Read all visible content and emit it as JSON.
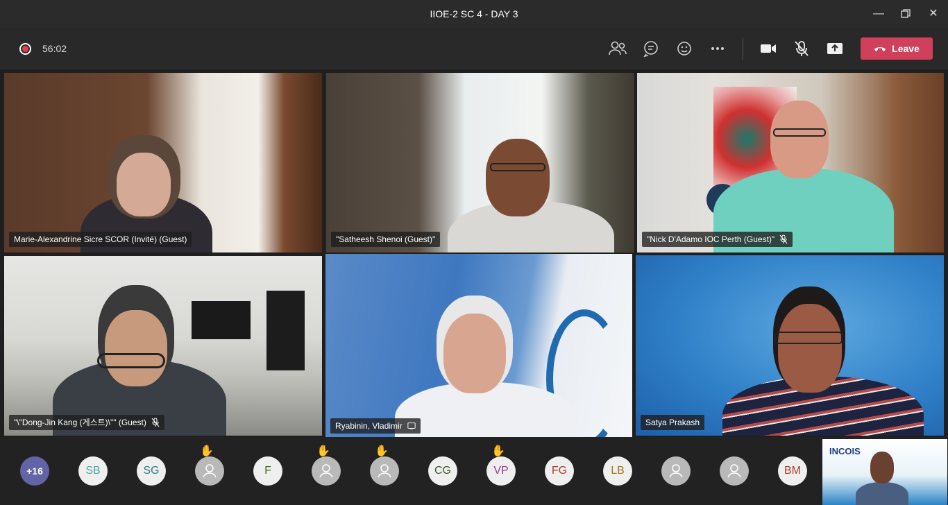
{
  "window": {
    "title": "IIOE-2 SC 4 - DAY 3"
  },
  "toolbar": {
    "timer": "56:02",
    "leave_label": "Leave",
    "icons": [
      "participants-icon",
      "chat-icon",
      "reactions-icon",
      "more-icon",
      "camera-icon",
      "mic-muted-icon",
      "share-icon"
    ],
    "leave_color": "#d0405a"
  },
  "tiles": [
    {
      "name": "Marie-Alexandrine Sicre SCOR (Invité) (Guest)",
      "muted": false
    },
    {
      "name": "\"Satheesh Shenoi (Guest)\"",
      "muted": false
    },
    {
      "name": "\"Nick D'Adamo IOC Perth (Guest)\"",
      "muted": true
    },
    {
      "name": "\"\\\"Dong-Jin Kang (게스트)\\\"\" (Guest)",
      "muted": true
    },
    {
      "name": "Ryabinin, Vladimir",
      "muted": false
    },
    {
      "name": "Satya Prakash",
      "muted": false
    }
  ],
  "roster": {
    "more_label": "+16",
    "avatars": [
      {
        "type": "initials",
        "label": "SB",
        "color": "#4aa8a0",
        "hand": false
      },
      {
        "type": "initials",
        "label": "SG",
        "color": "#2f7a8a",
        "hand": false
      },
      {
        "type": "photo",
        "label": "",
        "hand": true
      },
      {
        "type": "initials",
        "label": "F",
        "color": "#4a6a2a",
        "hand": false
      },
      {
        "type": "photo",
        "label": "",
        "hand": true
      },
      {
        "type": "photo",
        "label": "",
        "hand": true
      },
      {
        "type": "initials",
        "label": "CG",
        "color": "#3a5a2a",
        "hand": false
      },
      {
        "type": "initials",
        "label": "VP",
        "color": "#9a3a8a",
        "hand": true
      },
      {
        "type": "initials",
        "label": "FG",
        "color": "#b03a2a",
        "hand": false
      },
      {
        "type": "initials",
        "label": "LB",
        "color": "#a0781a",
        "hand": false
      },
      {
        "type": "photo",
        "label": "",
        "hand": false
      },
      {
        "type": "photo",
        "label": "",
        "hand": false
      },
      {
        "type": "initials",
        "label": "BM",
        "color": "#b03a2a",
        "hand": false
      }
    ]
  },
  "self_view": {
    "logo_text": "INCOIS"
  }
}
